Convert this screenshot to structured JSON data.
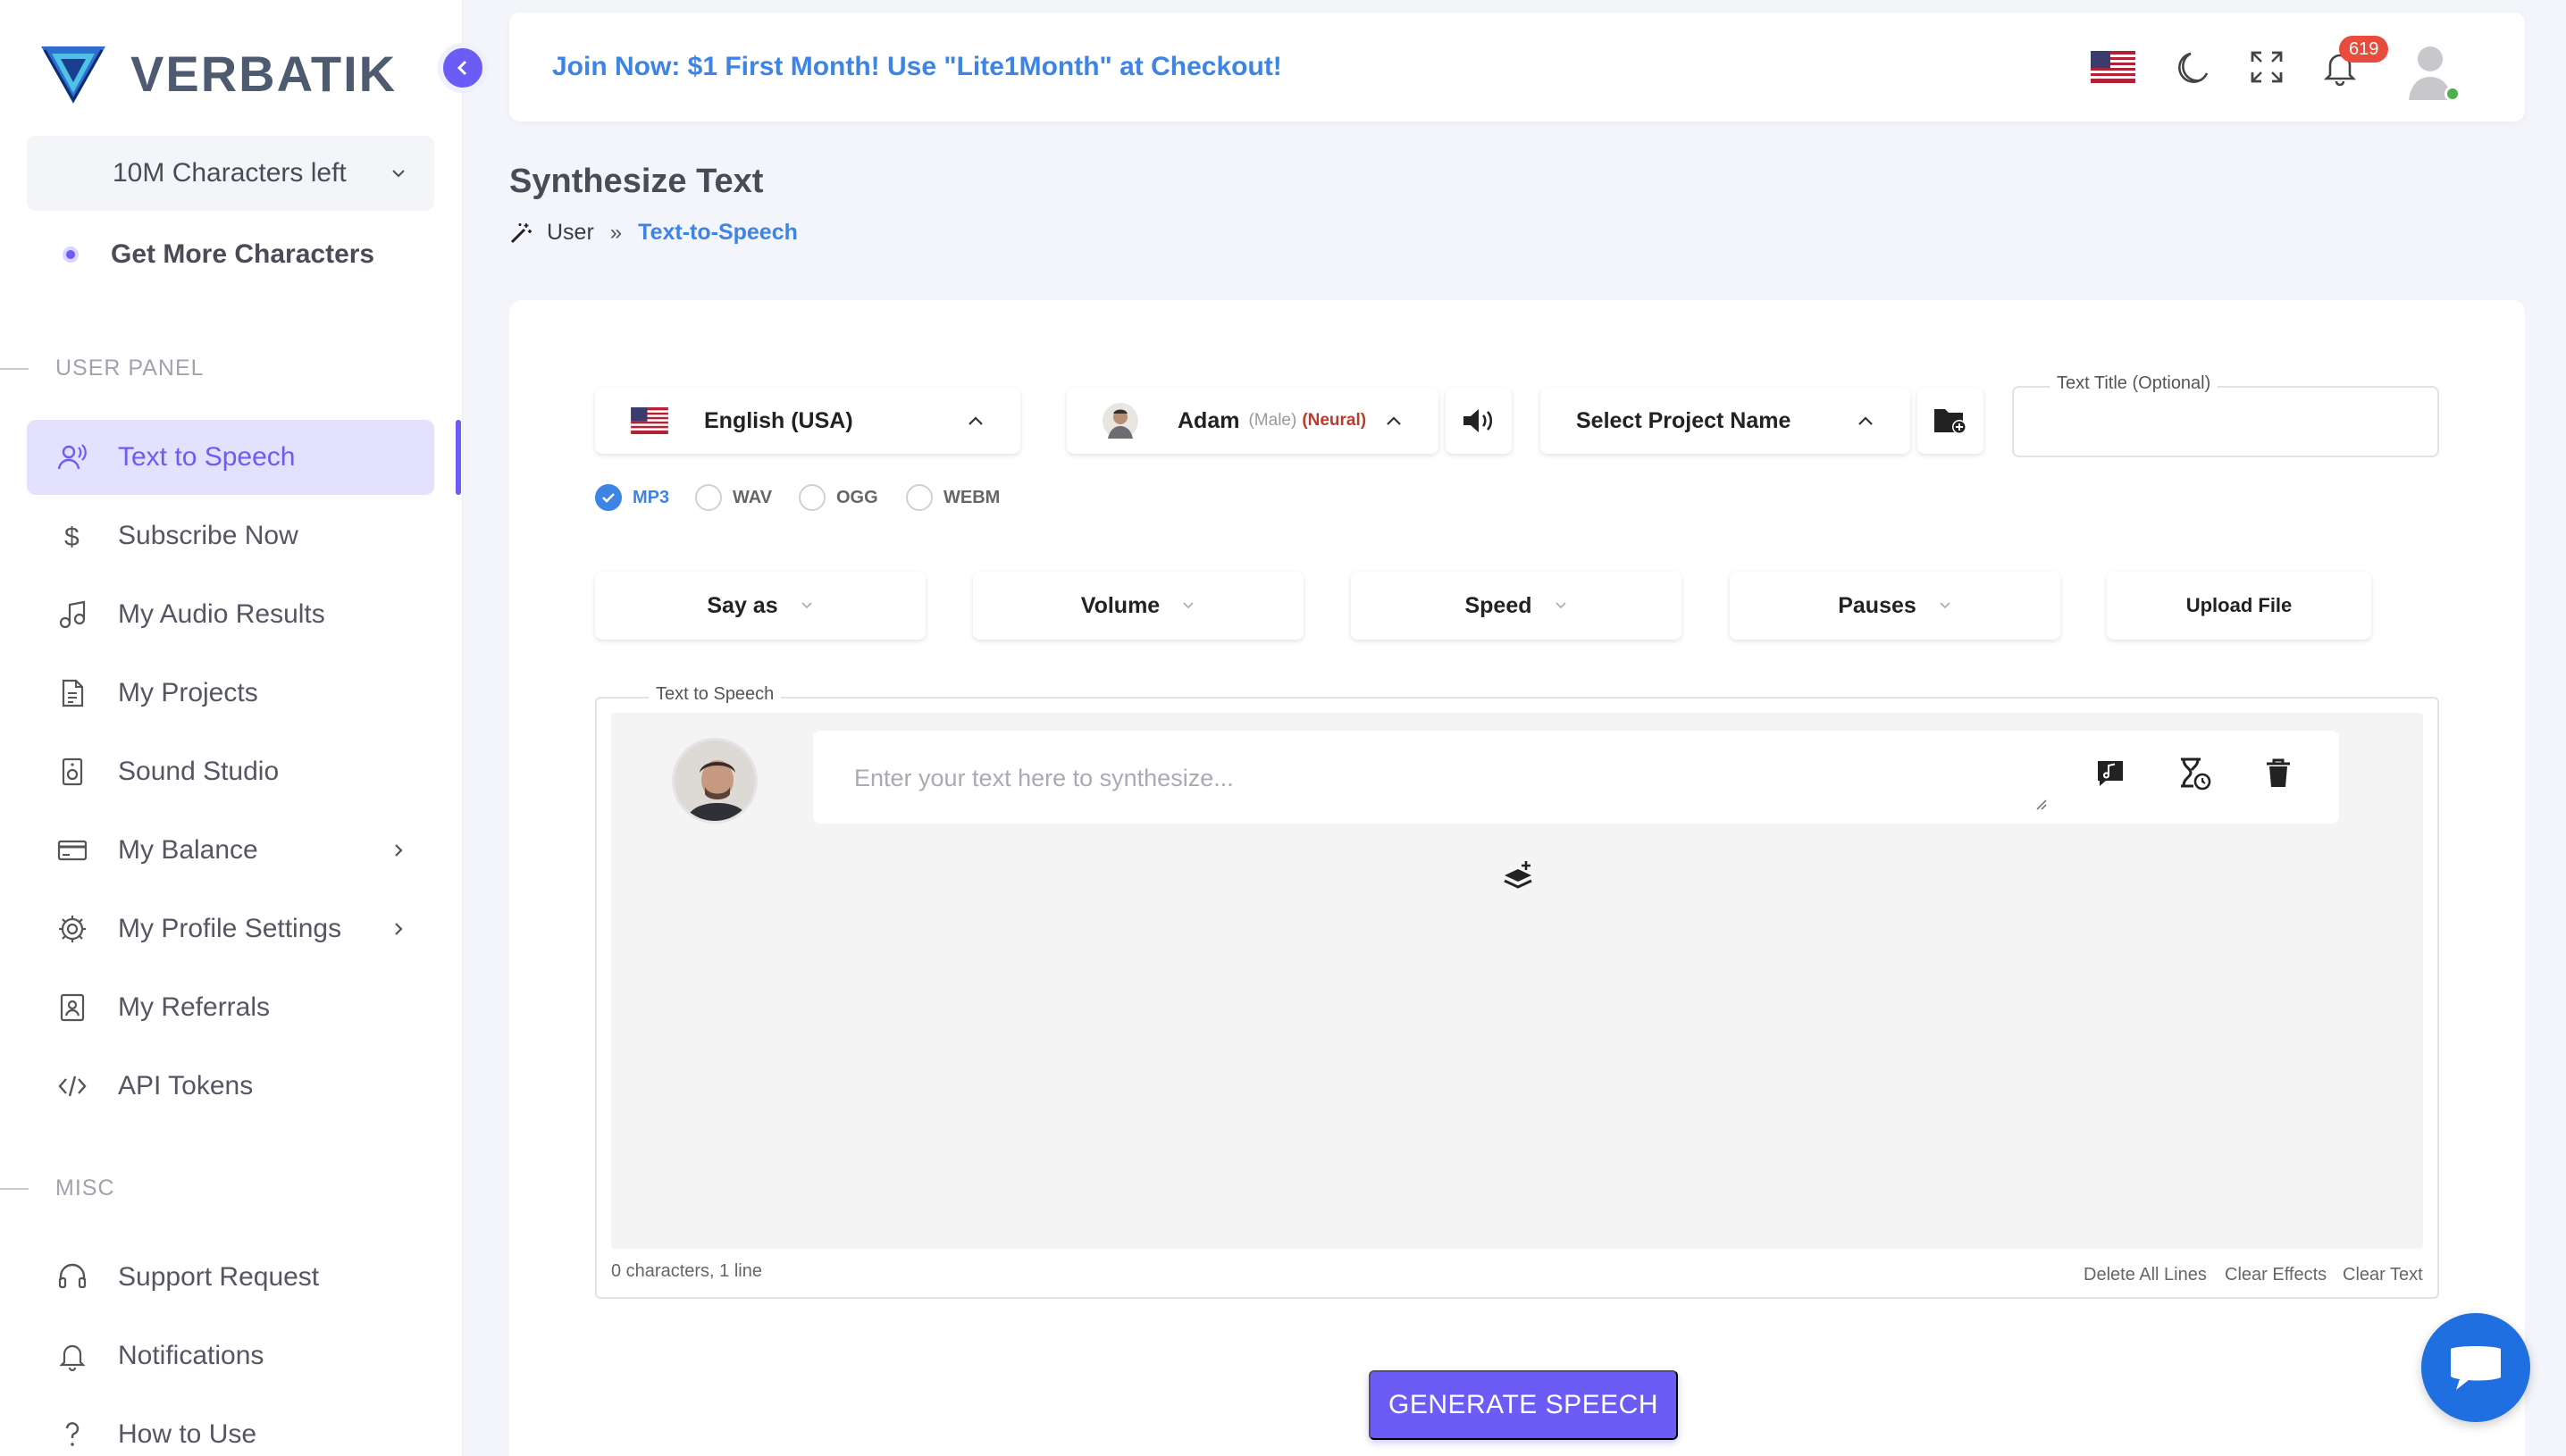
{
  "brand": {
    "name": "VERBATIK",
    "accent": "#6b5cf6"
  },
  "sidebar": {
    "characters_left": "10M Characters left",
    "get_more": "Get More Characters",
    "sections": {
      "user_panel": "USER PANEL",
      "misc": "MISC"
    },
    "items": [
      {
        "label": "Text to Speech",
        "icon": "microphone-user-icon",
        "active": true
      },
      {
        "label": "Subscribe Now",
        "icon": "dollar-icon"
      },
      {
        "label": "My Audio Results",
        "icon": "music-note-icon"
      },
      {
        "label": "My Projects",
        "icon": "document-icon"
      },
      {
        "label": "Sound Studio",
        "icon": "speaker-icon"
      },
      {
        "label": "My Balance",
        "icon": "credit-card-icon"
      },
      {
        "label": "My Profile Settings",
        "icon": "gear-icon"
      },
      {
        "label": "My Referrals",
        "icon": "contact-card-icon"
      },
      {
        "label": "API Tokens",
        "icon": "code-icon"
      }
    ],
    "misc_items": [
      {
        "label": "Support Request",
        "icon": "headset-icon"
      },
      {
        "label": "Notifications",
        "icon": "bell-icon"
      },
      {
        "label": "How to Use",
        "icon": "question-icon"
      }
    ]
  },
  "topbar": {
    "promo": "Join Now: $1 First Month! Use \"Lite1Month\" at Checkout!",
    "notification_count": "619"
  },
  "page": {
    "title": "Synthesize Text",
    "breadcrumb": {
      "root": "User",
      "separator": "»",
      "current": "Text-to-Speech"
    }
  },
  "controls": {
    "language": "English (USA)",
    "voice": {
      "name": "Adam",
      "gender": "(Male)",
      "type": "(Neural)"
    },
    "project": "Select Project Name",
    "text_title_label": "Text Title (Optional)",
    "formats": [
      "MP3",
      "WAV",
      "OGG",
      "WEBM"
    ],
    "selected_format": "MP3",
    "options": [
      "Say as",
      "Volume",
      "Speed",
      "Pauses"
    ],
    "upload": "Upload File"
  },
  "editor": {
    "legend": "Text to Speech",
    "placeholder": "Enter your text here to synthesize...",
    "status": "0 characters, 1 line",
    "links": [
      "Delete All Lines",
      "Clear Effects",
      "Clear Text"
    ]
  },
  "generate_label": "GENERATE SPEECH"
}
